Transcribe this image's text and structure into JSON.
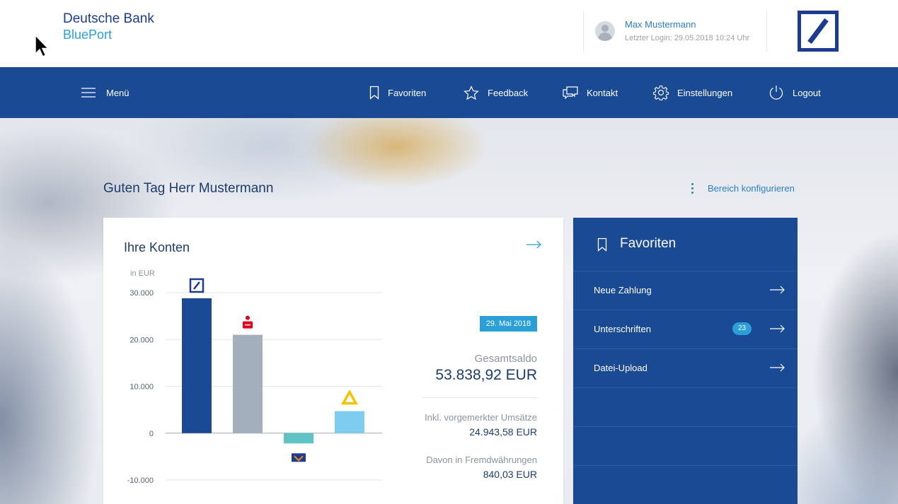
{
  "brand": {
    "line1": "Deutsche Bank",
    "line2": "BluePort"
  },
  "user": {
    "name": "Max Mustermann",
    "last_login": "Letzter Login: 29.05.2018 10:24 Uhr"
  },
  "nav": {
    "menu": "Menü",
    "favorites": "Favoriten",
    "feedback": "Feedback",
    "contact": "Kontakt",
    "settings": "Einstellungen",
    "logout": "Logout"
  },
  "greeting": "Guten Tag Herr Mustermann",
  "configure": "Bereich konfigurieren",
  "accounts": {
    "title": "Ihre Konten",
    "date": "29. Mai 2018",
    "total_label": "Gesamtsaldo",
    "total_value": "53.838,92 EUR",
    "pending_label": "Inkl. vorgemerkter Umsätze",
    "pending_value": "24.943,58 EUR",
    "fx_label": "Davon in Fremdwährungen",
    "fx_value": "840,03 EUR"
  },
  "chart_data": {
    "type": "bar",
    "unit_label": "in EUR",
    "ylim": [
      -10000,
      30000
    ],
    "ticks": [
      {
        "value": 30000,
        "label": "30.000"
      },
      {
        "value": 20000,
        "label": "20.000"
      },
      {
        "value": 10000,
        "label": "10.000"
      },
      {
        "value": 0,
        "label": "0"
      },
      {
        "value": -10000,
        "label": "-10.000"
      }
    ],
    "categories": [
      "deutsche-bank",
      "sparkasse",
      "volksbank",
      "commerzbank"
    ],
    "values": [
      28800,
      21000,
      -2200,
      4700
    ],
    "colors": [
      "#1a4a94",
      "#a3afbd",
      "#5ec4c3",
      "#7dcdf0"
    ],
    "grid": true
  },
  "favorites": {
    "title": "Favoriten",
    "items": [
      {
        "label": "Neue Zahlung",
        "badge": ""
      },
      {
        "label": "Unterschriften",
        "badge": "23"
      },
      {
        "label": "Datei-Upload",
        "badge": ""
      }
    ]
  }
}
